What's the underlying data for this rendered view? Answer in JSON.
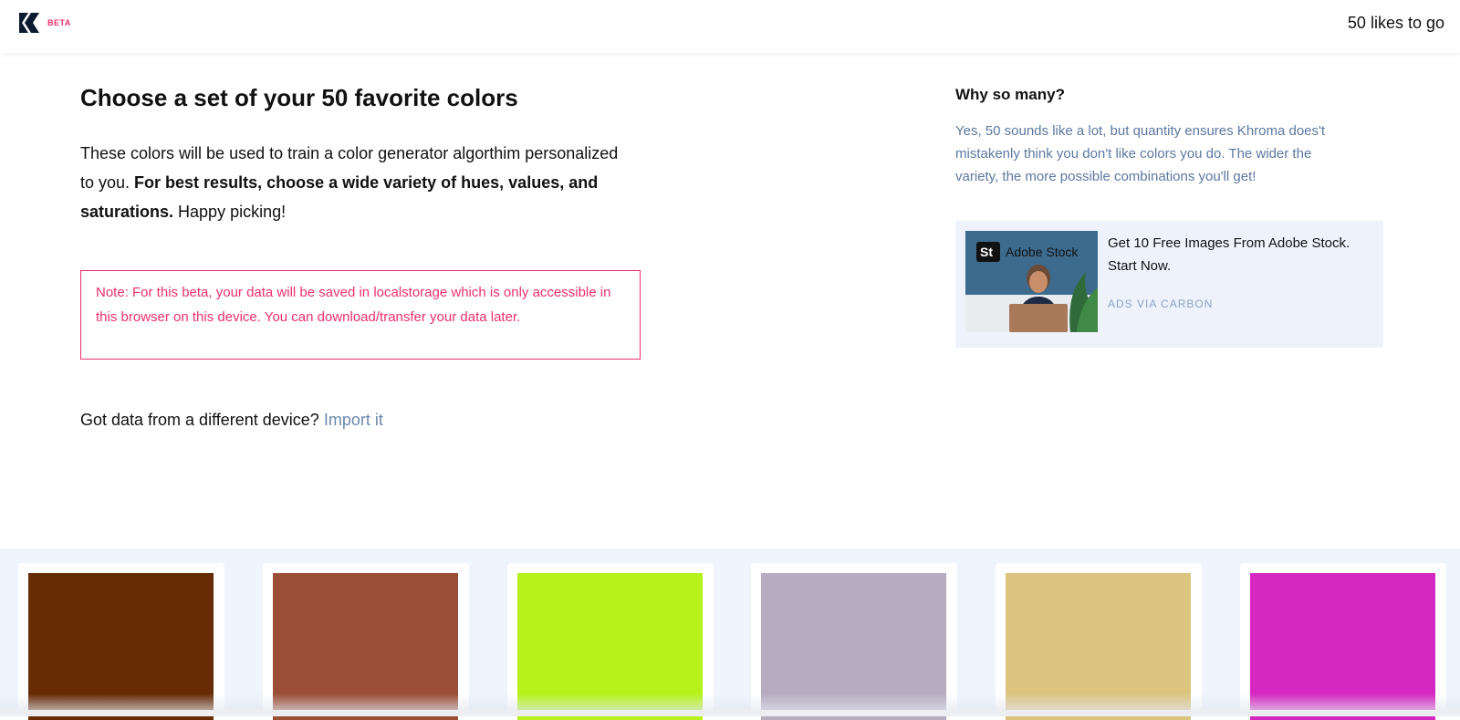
{
  "header": {
    "beta_label": "BETA",
    "likes_to_go": "50 likes to go"
  },
  "main": {
    "title": "Choose a set of your 50 favorite colors",
    "intro_plain_1": "These colors will be used to train a color generator algorthim personalized to you. ",
    "intro_bold": "For best results, choose a wide variety of hues, values, and saturations.",
    "intro_plain_2": " Happy picking!",
    "note": "Note: For this beta, your data will be saved in localstorage which is only accessible in this browser on this device. You can download/transfer your data later.",
    "import_prompt": "Got data from a different device?",
    "import_link": "Import it"
  },
  "sidebar": {
    "why_title": "Why so many?",
    "why_text": "Yes, 50 sounds like a lot, but quantity ensures Khroma does't mistakenly think you don't like colors you do. The wider the variety, the more possible combinations you'll get!"
  },
  "ad": {
    "image_brand_mark": "St",
    "image_brand_name": "Adobe Stock",
    "text": "Get 10 Free Images From Adobe Stock. Start Now.",
    "via": "ADS VIA CARBON"
  },
  "colors": {
    "accent": "#f0306a",
    "link": "#6d88ad",
    "swatches": [
      "#672b05",
      "#9b4e36",
      "#b6f21a",
      "#b5adbf",
      "#dcc47f",
      "#d528c1"
    ]
  }
}
